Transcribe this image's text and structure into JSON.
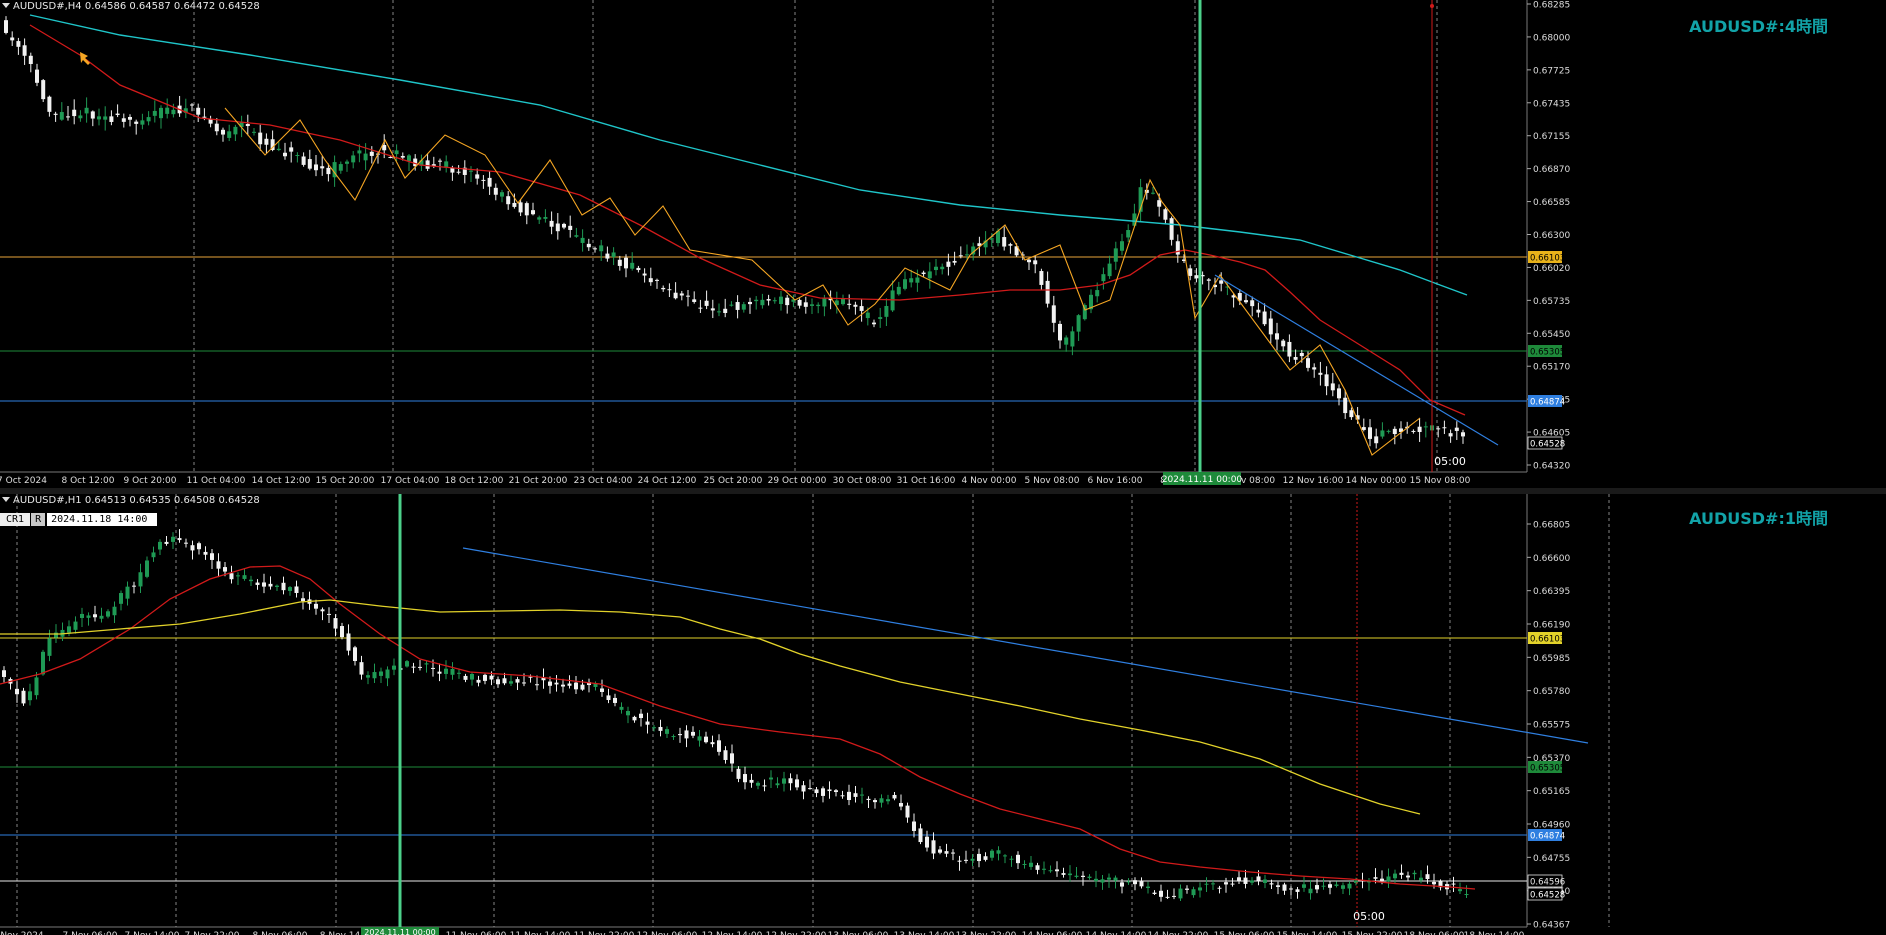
{
  "colors": {
    "bull": "#1f9a55",
    "bear": "#f2f2f2",
    "watermark": "#12a3a8",
    "ma_fast": "#d11a1a",
    "ma_slow4h": "#1fc5c9",
    "ma_slow1h": "#e2d22a",
    "zigzag": "#f5a623",
    "trend": "#2f7fe0",
    "vline_green": "#4cd08a",
    "vline_red": "#d11a1a"
  },
  "top": {
    "symbol_line": "AUDUSD#,H4  0.64586 0.64587 0.64472 0.64528",
    "watermark": "AUDUSD#:4時間",
    "vline_label": "2024.11.11 00:00",
    "time_marker": "05:00",
    "price_ticks": [
      "0.68285",
      "0.68000",
      "0.67725",
      "0.67435",
      "0.67155",
      "0.66870",
      "0.66585",
      "0.66300",
      "0.66020",
      "0.65735",
      "0.65450",
      "0.65170",
      "0.64885",
      "0.64605",
      "0.64320"
    ],
    "hlines": [
      {
        "price": "0.66103",
        "color": "#e8a33a",
        "label_bg": "#e8b21a",
        "label_fg": "#000"
      },
      {
        "price": "0.65305",
        "color": "#1e8a3a",
        "label_bg": "#1e8a3a",
        "label_fg": "#000"
      },
      {
        "price": "0.64874",
        "color": "#2f7fe0",
        "label_bg": "#2f7fe0",
        "label_fg": "#fff"
      }
    ],
    "current_price": "0.64528",
    "time_labels": [
      "7 Oct 2024",
      "8 Oct 12:00",
      "9 Oct 20:00",
      "11 Oct 04:00",
      "14 Oct 12:00",
      "15 Oct 20:00",
      "17 Oct 04:00",
      "18 Oct 12:00",
      "21 Oct 20:00",
      "23 Oct 04:00",
      "24 Oct 12:00",
      "25 Oct 20:00",
      "29 Oct 00:00",
      "30 Oct 08:00",
      "31 Oct 16:00",
      "4 Nov 00:00",
      "5 Nov 08:00",
      "6 Nov 16:00",
      "8",
      "v 08:00",
      "12 Nov 16:00",
      "14 Nov 00:00",
      "15 Nov 08:00"
    ]
  },
  "bottom": {
    "symbol_line": "AUDUSD#,H1  0.64513 0.64535 0.64508 0.64528",
    "ruler": {
      "cr1": "CR1",
      "r": "R",
      "datetime": "2024.11.18 14:00"
    },
    "watermark": "AUDUSD#:1時間",
    "time_marker": "05:00",
    "price_ticks": [
      "0.66805",
      "0.66600",
      "0.66395",
      "0.66190",
      "0.65985",
      "0.65780",
      "0.65575",
      "0.65370",
      "0.65165",
      "0.64960",
      "0.64755",
      "0.64550",
      "0.64367"
    ],
    "hlines": [
      {
        "price": "0.66103",
        "color": "#e2d22a",
        "label_bg": "#e2d22a",
        "label_fg": "#000"
      },
      {
        "price": "0.65305",
        "color": "#1e8a3a",
        "label_bg": "#1e8a3a",
        "label_fg": "#000"
      },
      {
        "price": "0.64874",
        "color": "#2f7fe0",
        "label_bg": "#2f7fe0",
        "label_fg": "#fff"
      },
      {
        "price": "0.64596",
        "color": "#e8e8e8",
        "label_bg": "#000",
        "label_fg": "#e8e8e8"
      }
    ],
    "current_price": "0.64528",
    "vline_label": "2024.11.11 00:00",
    "time_labels": [
      "Nov 2024",
      "7 Nov 06:00",
      "7 Nov 14:00",
      "7 Nov 22:00",
      "8 Nov 06:00",
      "8 Nov 14",
      "11 Nov 06:00",
      "11 Nov 14:00",
      "11 Nov 22:00",
      "12 Nov 06:00",
      "12 Nov 14:00",
      "12 Nov 22:00",
      "13 Nov 06:00",
      "13 Nov 14:00",
      "13 Nov 22:00",
      "14 Nov 06:00",
      "14 Nov 14:00",
      "14 Nov 22:00",
      "15 Nov 06:00",
      "15 Nov 14:00",
      "15 Nov 22:00",
      "18 Nov 06:00",
      "18 Nov 14:00"
    ]
  }
}
